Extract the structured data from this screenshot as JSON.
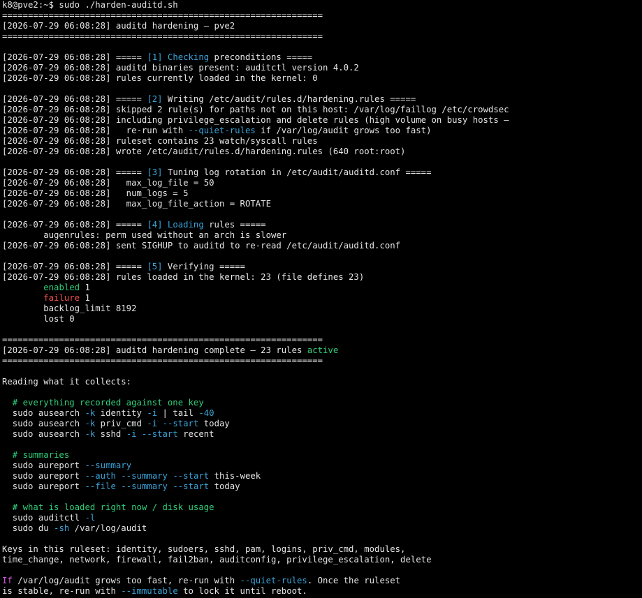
{
  "terminal": {
    "colors": {
      "background": "#000000",
      "default": "#e5e5e5",
      "blue": "#3aa3d8",
      "green": "#2fcf7a",
      "red": "#f0504a",
      "magenta": "#d25ad8"
    },
    "lines": [
      [
        {
          "t": "k8@pve2:~$ sudo ./harden-auditd.sh",
          "c": "default"
        }
      ],
      [
        {
          "t": "==============================================================",
          "c": "default"
        }
      ],
      [
        {
          "t": "[2026-07-29 06:08:28] auditd hardening — pve2",
          "c": "default"
        }
      ],
      [
        {
          "t": "==============================================================",
          "c": "default"
        }
      ],
      [],
      [
        {
          "t": "[2026-07-29 06:08:28] ===== ",
          "c": "default"
        },
        {
          "t": "[1] Checking",
          "c": "blue"
        },
        {
          "t": " preconditions =====",
          "c": "default"
        }
      ],
      [
        {
          "t": "[2026-07-29 06:08:28] auditd binaries present: auditctl version 4.0.2",
          "c": "default"
        }
      ],
      [
        {
          "t": "[2026-07-29 06:08:28] rules currently loaded in the kernel: 0",
          "c": "default"
        }
      ],
      [],
      [
        {
          "t": "[2026-07-29 06:08:28] ===== ",
          "c": "default"
        },
        {
          "t": "[2]",
          "c": "blue"
        },
        {
          "t": " Writing /etc/audit/rules.d/hardening.rules =====",
          "c": "default"
        }
      ],
      [
        {
          "t": "[2026-07-29 06:08:28] skipped 2 rule(s) for paths not on this host: /var/log/faillog /etc/crowdsec",
          "c": "default"
        }
      ],
      [
        {
          "t": "[2026-07-29 06:08:28] including privilege_escalation and delete rules (high volume on busy hosts —",
          "c": "default"
        }
      ],
      [
        {
          "t": "[2026-07-29 06:08:28]   re-run with ",
          "c": "default"
        },
        {
          "t": "--quiet-rules",
          "c": "blue"
        },
        {
          "t": " if /var/log/audit grows too fast)",
          "c": "default"
        }
      ],
      [
        {
          "t": "[2026-07-29 06:08:28] ruleset contains 23 watch/syscall rules",
          "c": "default"
        }
      ],
      [
        {
          "t": "[2026-07-29 06:08:28] wrote /etc/audit/rules.d/hardening.rules (640 root:root)",
          "c": "default"
        }
      ],
      [],
      [
        {
          "t": "[2026-07-29 06:08:28] ===== ",
          "c": "default"
        },
        {
          "t": "[3]",
          "c": "blue"
        },
        {
          "t": " Tuning log rotation in /etc/audit/auditd.conf =====",
          "c": "default"
        }
      ],
      [
        {
          "t": "[2026-07-29 06:08:28]   max_log_file = 50",
          "c": "default"
        }
      ],
      [
        {
          "t": "[2026-07-29 06:08:28]   num_logs = 5",
          "c": "default"
        }
      ],
      [
        {
          "t": "[2026-07-29 06:08:28]   max_log_file_action = ROTATE",
          "c": "default"
        }
      ],
      [],
      [
        {
          "t": "[2026-07-29 06:08:28] ===== ",
          "c": "default"
        },
        {
          "t": "[4] Loading",
          "c": "blue"
        },
        {
          "t": " rules =====",
          "c": "default"
        }
      ],
      [
        {
          "t": "        augenrules: perm used without an arch is slower",
          "c": "default"
        }
      ],
      [
        {
          "t": "[2026-07-29 06:08:28] sent SIGHUP to auditd to re-read /etc/audit/auditd.conf",
          "c": "default"
        }
      ],
      [],
      [
        {
          "t": "[2026-07-29 06:08:28] ===== ",
          "c": "default"
        },
        {
          "t": "[5]",
          "c": "blue"
        },
        {
          "t": " Verifying =====",
          "c": "default"
        }
      ],
      [
        {
          "t": "[2026-07-29 06:08:28] rules loaded in the kernel: 23 (file defines 23)",
          "c": "default"
        }
      ],
      [
        {
          "t": "        ",
          "c": "default"
        },
        {
          "t": "enabled",
          "c": "green"
        },
        {
          "t": " 1",
          "c": "default"
        }
      ],
      [
        {
          "t": "        ",
          "c": "default"
        },
        {
          "t": "failure",
          "c": "red"
        },
        {
          "t": " 1",
          "c": "default"
        }
      ],
      [
        {
          "t": "        backlog_limit 8192",
          "c": "default"
        }
      ],
      [
        {
          "t": "        lost 0",
          "c": "default"
        }
      ],
      [],
      [
        {
          "t": "==============================================================",
          "c": "default"
        }
      ],
      [
        {
          "t": "[2026-07-29 06:08:28] auditd hardening complete — 23 rules ",
          "c": "default"
        },
        {
          "t": "active",
          "c": "green"
        }
      ],
      [
        {
          "t": "==============================================================",
          "c": "default"
        }
      ],
      [],
      [
        {
          "t": "Reading what it collects:",
          "c": "default"
        }
      ],
      [],
      [
        {
          "t": "  # everything recorded against one key",
          "c": "green"
        }
      ],
      [
        {
          "t": "  sudo ausearch ",
          "c": "default"
        },
        {
          "t": "-k",
          "c": "blue"
        },
        {
          "t": " identity ",
          "c": "default"
        },
        {
          "t": "-i",
          "c": "blue"
        },
        {
          "t": " | tail ",
          "c": "default"
        },
        {
          "t": "-40",
          "c": "blue"
        }
      ],
      [
        {
          "t": "  sudo ausearch ",
          "c": "default"
        },
        {
          "t": "-k",
          "c": "blue"
        },
        {
          "t": " priv_cmd ",
          "c": "default"
        },
        {
          "t": "-i --start",
          "c": "blue"
        },
        {
          "t": " today",
          "c": "default"
        }
      ],
      [
        {
          "t": "  sudo ausearch ",
          "c": "default"
        },
        {
          "t": "-k",
          "c": "blue"
        },
        {
          "t": " sshd ",
          "c": "default"
        },
        {
          "t": "-i --start",
          "c": "blue"
        },
        {
          "t": " recent",
          "c": "default"
        }
      ],
      [],
      [
        {
          "t": "  # summaries",
          "c": "green"
        }
      ],
      [
        {
          "t": "  sudo aureport ",
          "c": "default"
        },
        {
          "t": "--summary",
          "c": "blue"
        }
      ],
      [
        {
          "t": "  sudo aureport ",
          "c": "default"
        },
        {
          "t": "--auth --summary --start",
          "c": "blue"
        },
        {
          "t": " this-week",
          "c": "default"
        }
      ],
      [
        {
          "t": "  sudo aureport ",
          "c": "default"
        },
        {
          "t": "--file --summary --start",
          "c": "blue"
        },
        {
          "t": " today",
          "c": "default"
        }
      ],
      [],
      [
        {
          "t": "  # what is loaded right now / disk usage",
          "c": "green"
        }
      ],
      [
        {
          "t": "  sudo auditctl ",
          "c": "default"
        },
        {
          "t": "-l",
          "c": "blue"
        }
      ],
      [
        {
          "t": "  sudo du ",
          "c": "default"
        },
        {
          "t": "-sh",
          "c": "blue"
        },
        {
          "t": " /var/log/audit",
          "c": "default"
        }
      ],
      [],
      [
        {
          "t": "Keys in this ruleset: identity, sudoers, sshd, pam, logins, priv_cmd, modules,",
          "c": "default"
        }
      ],
      [
        {
          "t": "time_change, network, firewall, fail2ban, auditconfig, privilege_escalation, delete",
          "c": "default"
        }
      ],
      [],
      [
        {
          "t": "If",
          "c": "magenta"
        },
        {
          "t": " /var/log/audit grows too fast, re-run with ",
          "c": "default"
        },
        {
          "t": "--quiet-rules",
          "c": "blue"
        },
        {
          "t": ". Once the ruleset",
          "c": "default"
        }
      ],
      [
        {
          "t": "is stable, re-run with ",
          "c": "default"
        },
        {
          "t": "--immutable",
          "c": "blue"
        },
        {
          "t": " to lock it until reboot.",
          "c": "default"
        }
      ]
    ]
  }
}
